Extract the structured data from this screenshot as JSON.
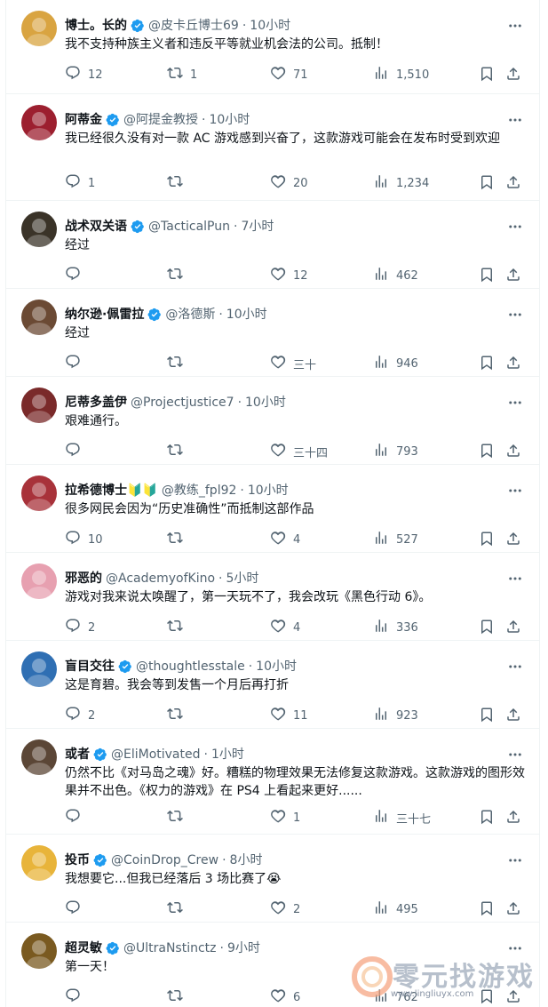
{
  "tweets": [
    {
      "name": "博士。长的",
      "handle": "@皮卡丘博士69",
      "time": "10小时",
      "verified": true,
      "text": "我不支持种族主义者和违反平等就业机会法的公司。抵制！",
      "replies": "12",
      "retweets": "1",
      "likes": "71",
      "views": "1,510",
      "avatar_color": "#d9a441"
    },
    {
      "name": "阿蒂金",
      "handle": "@阿提金教授",
      "time": "10小时",
      "verified": true,
      "text": "我已经很久没有对一款 AC 游戏感到兴奋了，这款游戏可能会在发布时受到欢迎",
      "replies": "1",
      "retweets": "",
      "likes": "20",
      "views": "1,234",
      "avatar_color": "#9c1f2f"
    },
    {
      "name": "战术双关语",
      "handle": "@TacticalPun",
      "time": "7小时",
      "verified": true,
      "text": "经过",
      "replies": "",
      "retweets": "",
      "likes": "12",
      "views": "462",
      "avatar_color": "#3a3328"
    },
    {
      "name": "纳尔逊·佩雷拉",
      "handle": "@洛德斯",
      "time": "10小时",
      "verified": true,
      "text": "经过",
      "replies": "",
      "retweets": "",
      "likes": "三十",
      "views": "946",
      "avatar_color": "#6b4a34"
    },
    {
      "name": "尼蒂多盖伊",
      "handle": "@Projectjustice7",
      "time": "10小时",
      "verified": false,
      "text": "艰难通行。",
      "replies": "",
      "retweets": "",
      "likes": "三十四",
      "views": "793",
      "avatar_color": "#7a2a2a"
    },
    {
      "name": "拉希德博士🔰🔰",
      "handle": "@教练_fpl92",
      "time": "10小时",
      "verified": false,
      "text": "很多网民会因为“历史准确性”而抵制这部作品",
      "replies": "10",
      "retweets": "",
      "likes": "4",
      "views": "527",
      "avatar_color": "#a8323a"
    },
    {
      "name": "邪恶的",
      "handle": "@AcademyofKino",
      "time": "5小时",
      "verified": false,
      "text": "游戏对我来说太唤醒了，第一天玩不了，我会改玩《黑色行动 6》。",
      "replies": "2",
      "retweets": "",
      "likes": "4",
      "views": "336",
      "avatar_color": "#e7a0b0"
    },
    {
      "name": "盲目交往",
      "handle": "@thoughtlesstale",
      "time": "10小时",
      "verified": true,
      "text": "这是育碧。我会等到发售一个月后再打折",
      "replies": "2",
      "retweets": "",
      "likes": "11",
      "views": "923",
      "avatar_color": "#2f6fb3"
    },
    {
      "name": "或者",
      "handle": "@EliMotivated",
      "time": "1小时",
      "verified": true,
      "text": "仍然不比《对马岛之魂》好。糟糕的物理效果无法修复这款游戏。这款游戏的图形效果并不出色。《权力的游戏》在 PS4 上看起来更好......",
      "replies": "",
      "retweets": "",
      "likes": "1",
      "views": "三十七",
      "avatar_color": "#5b4636"
    },
    {
      "name": "投币",
      "handle": "@CoinDrop_Crew",
      "time": "8小时",
      "verified": true,
      "text": "我想要它...但我已经落后 3 场比赛了😭",
      "replies": "",
      "retweets": "",
      "likes": "2",
      "views": "495",
      "avatar_color": "#e8b43a"
    },
    {
      "name": "超灵敏",
      "handle": "@UltraNstinctz",
      "time": "9小时",
      "verified": true,
      "text": "第一天！",
      "replies": "",
      "retweets": "",
      "likes": "6",
      "views": "762",
      "avatar_color": "#7a5a20"
    }
  ],
  "colors": {
    "verified": "#1d9bf0",
    "muted": "#536471",
    "text": "#0f1419"
  },
  "icons": {
    "reply": "reply-icon",
    "retweet": "retweet-icon",
    "like": "heart-icon",
    "views": "views-icon",
    "bookmark": "bookmark-icon",
    "share": "share-icon",
    "more": "more-icon"
  },
  "watermark": {
    "title": "零元找游戏",
    "url": "www.lingliuyx.com"
  }
}
